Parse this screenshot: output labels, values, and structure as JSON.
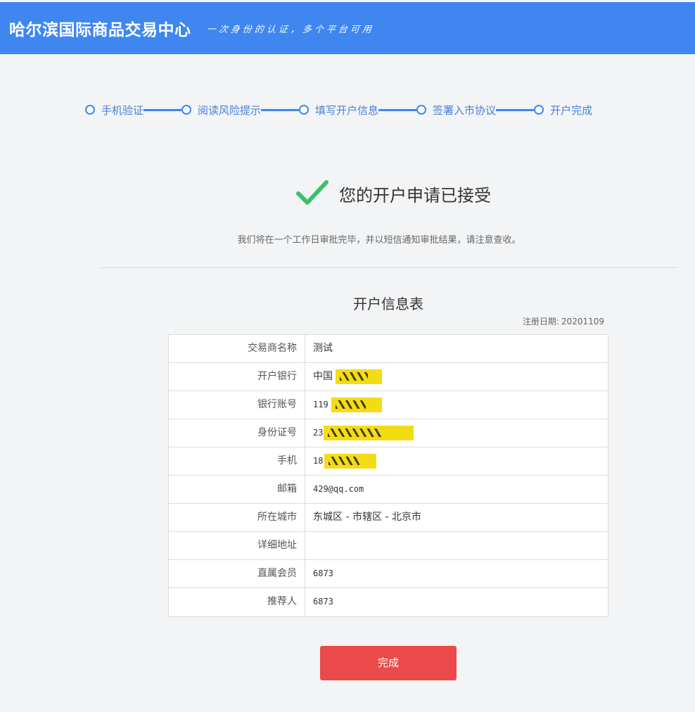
{
  "header": {
    "brand": "哈尔滨国际商品交易中心",
    "slogan": "一次身份的认证，多个平台可用"
  },
  "steps": [
    {
      "label": "手机验证"
    },
    {
      "label": "阅读风险提示"
    },
    {
      "label": "填写开户信息"
    },
    {
      "label": "签署入市协议"
    },
    {
      "label": "开户完成"
    }
  ],
  "result": {
    "title": "您的开户申请已接受",
    "notice": "我们将在一个工作日审批完毕，并以短信通知审批结果，请注意查收。"
  },
  "info_table": {
    "title": "开户信息表",
    "reg_date_label": "注册日期:",
    "reg_date": "20201109",
    "rows": [
      {
        "label": "交易商名称",
        "value": "测试"
      },
      {
        "label": "开户银行",
        "value": "中国"
      },
      {
        "label": "银行账号",
        "value": "119"
      },
      {
        "label": "身份证号",
        "value": "23"
      },
      {
        "label": "手机",
        "value": "18"
      },
      {
        "label": "邮箱",
        "value": "429@qq.com"
      },
      {
        "label": "所在城市",
        "value": "东城区 - 市辖区 - 北京市"
      },
      {
        "label": "详细地址",
        "value": ""
      },
      {
        "label": "直属会员",
        "value": "6873"
      },
      {
        "label": "推荐人",
        "value": "6873"
      }
    ]
  },
  "actions": {
    "finish_label": "完成"
  },
  "colors": {
    "header_bg": "#3f86f0",
    "step_color": "#3f86f0",
    "check_color": "#3cc06b",
    "button_bg": "#ea4a49",
    "redaction": "#f4dc14"
  }
}
